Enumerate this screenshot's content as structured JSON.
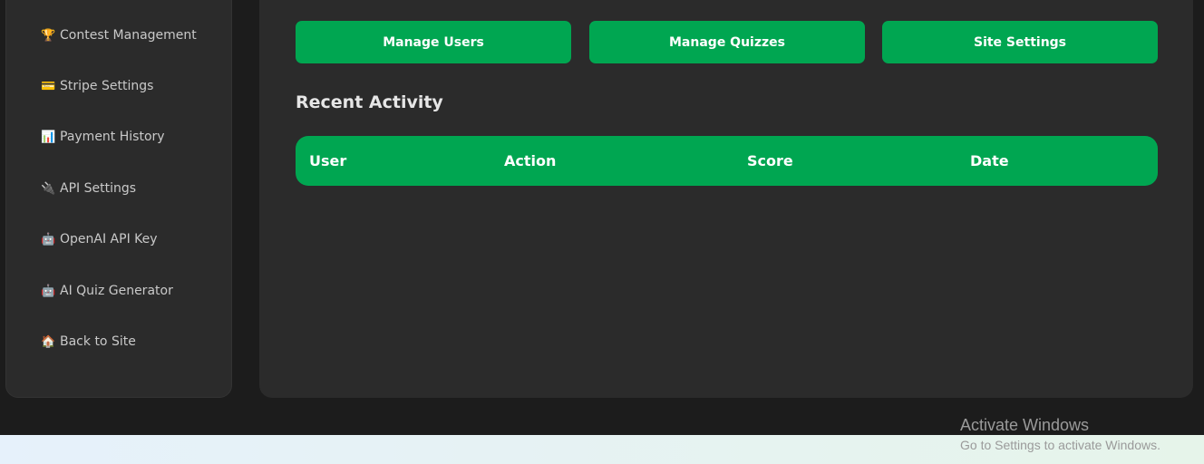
{
  "sidebar": {
    "items": [
      {
        "icon": "🏆",
        "icon_name": "trophy-icon",
        "label": "Contest Management"
      },
      {
        "icon": "💳",
        "icon_name": "credit-card-icon",
        "label": "Stripe Settings"
      },
      {
        "icon": "📊",
        "icon_name": "bar-chart-icon",
        "label": "Payment History"
      },
      {
        "icon": "🔌",
        "icon_name": "plug-icon",
        "label": "API Settings"
      },
      {
        "icon": "🤖",
        "icon_name": "robot-icon",
        "label": "OpenAI API Key"
      },
      {
        "icon": "🤖",
        "icon_name": "robot-icon",
        "label": "AI Quiz Generator"
      },
      {
        "icon": "🏠",
        "icon_name": "home-icon",
        "label": "Back to Site"
      }
    ]
  },
  "main": {
    "buttons": {
      "manage_users": "Manage Users",
      "manage_quizzes": "Manage Quizzes",
      "site_settings": "Site Settings"
    },
    "recent_activity": {
      "title": "Recent Activity",
      "columns": [
        "User",
        "Action",
        "Score",
        "Date"
      ]
    }
  },
  "watermark": {
    "title": "Activate Windows",
    "subtitle": "Go to Settings to activate Windows."
  },
  "colors": {
    "accent": "#00a651",
    "panel": "#2b2b2b",
    "background": "#1c1c1c"
  }
}
